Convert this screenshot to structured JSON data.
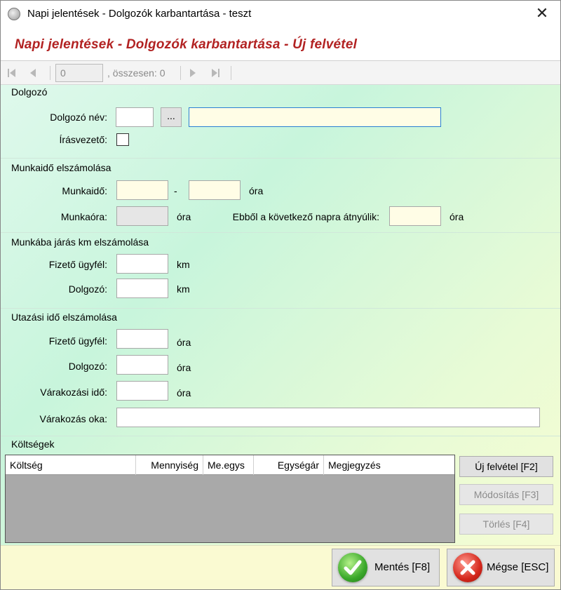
{
  "window": {
    "title": "Napi jelentések - Dolgozók karbantartása - teszt",
    "close_glyph": "✕"
  },
  "header": {
    "title": "Napi jelentések - Dolgozók karbantartása - Új felvétel"
  },
  "navigator": {
    "position": "0",
    "total_label": ", összesen: 0",
    "icons": [
      "first-record-icon",
      "previous-record-icon",
      "next-record-icon",
      "last-record-icon"
    ]
  },
  "dolgozo": {
    "section_title": "Dolgozó",
    "name_label": "Dolgozó név:",
    "code_value": "",
    "browse_label": "...",
    "name_value": "",
    "leader_label": "Írásvezető:",
    "leader_checked": false
  },
  "munkaido": {
    "section_title": "Munkaidő elszámolása",
    "time_label": "Munkaidő:",
    "from_value": "",
    "dash": "-",
    "to_value": "",
    "time_unit": "óra",
    "hours_label": "Munkaóra:",
    "hours_value": "",
    "hours_unit": "óra",
    "carryover_label": "Ebből a következő napra átnyúlik:",
    "carryover_value": "",
    "carryover_unit": "óra"
  },
  "km": {
    "section_title": "Munkába járás km elszámolása",
    "client_label": "Fizető ügyfél:",
    "client_value": "",
    "client_unit": "km",
    "employee_label": "Dolgozó:",
    "employee_value": "",
    "employee_unit": "km"
  },
  "utazas": {
    "section_title": "Utazási idő elszámolása",
    "client_label": "Fizető ügyfél:",
    "client_value": "",
    "client_unit": "óra",
    "employee_label": "Dolgozó:",
    "employee_value": "",
    "employee_unit": "óra",
    "wait_label": "Várakozási idő:",
    "wait_value": "",
    "wait_unit": "óra",
    "reason_label": "Várakozás oka:",
    "reason_value": ""
  },
  "koltsegek": {
    "section_title": "Költségek",
    "columns": [
      "Költség",
      "Mennyiség",
      "Me.egys",
      "Egységár",
      "Megjegyzés"
    ],
    "rows": [],
    "new_button": "Új felvétel [F2]",
    "edit_button": "Módosítás [F3]",
    "delete_button": "Törlés [F4]"
  },
  "footer": {
    "save_button": "Mentés [F8]",
    "cancel_button": "Mégse [ESC]"
  },
  "colors": {
    "header_title": "#b22222",
    "field_yellow": "#fffde6",
    "accent_border": "#2a7fd4"
  }
}
